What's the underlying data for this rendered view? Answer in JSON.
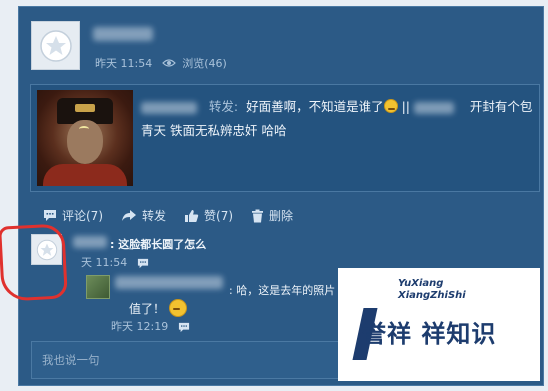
{
  "post": {
    "time": "昨天 11:54",
    "views": "浏览(46)",
    "repost_label": "转发:",
    "text_part1": "好面善啊，不知道是谁了",
    "separator": "||",
    "text_part2": "开封有个包青天 铁面无私辨忠奸 哈哈"
  },
  "actions": [
    {
      "label": "评论(7)"
    },
    {
      "label": "转发"
    },
    {
      "label": "赞(7)"
    },
    {
      "label": "删除"
    }
  ],
  "comment": {
    "text": ": 这脸都长圆了怎么",
    "time": "天 11:54"
  },
  "reply": {
    "text": ": 哈，这是去年的照片",
    "text2": "值了！",
    "time": "昨天 12:19"
  },
  "input": {
    "placeholder": "我也说一句"
  },
  "watermark": {
    "line1": "YuXiang",
    "line2": "XiangZhiShi",
    "main": "誉祥 祥知识"
  },
  "colors": {
    "card_bg": "#2c5a86",
    "highlight": "#e0312e",
    "watermark_blue": "#1d3c6e"
  }
}
